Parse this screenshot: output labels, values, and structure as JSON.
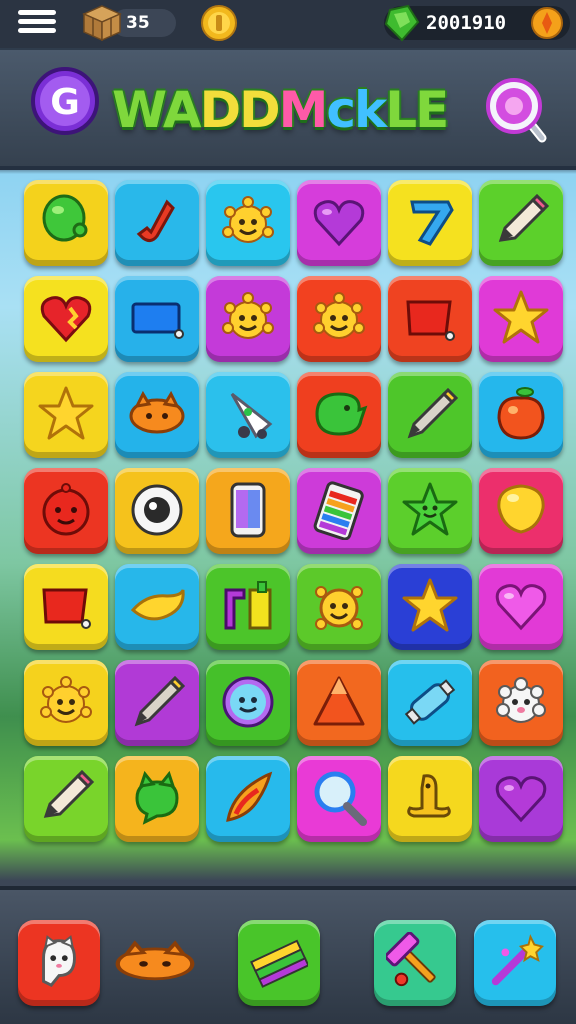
{
  "status_bar": {
    "crate_count": "35",
    "gem_balance": "2001910",
    "icons": [
      "menu-icon",
      "crate-icon",
      "coin-icon",
      "gem-icon",
      "coin-icon"
    ]
  },
  "banner": {
    "title_parts": [
      "WA",
      "DD",
      "M",
      "ck",
      "LE"
    ],
    "badge_letter": "G",
    "icons": [
      "g-badge-icon",
      "magnifier-icon"
    ]
  },
  "board": {
    "rows": 7,
    "columns": 6,
    "tiles": [
      {
        "color": "#f4d21c",
        "icon": "green-balloon-icon"
      },
      {
        "color": "#29b8ea",
        "icon": "red-hook-icon"
      },
      {
        "color": "#29c6ee",
        "icon": "sun-face-icon"
      },
      {
        "color": "#d63ddb",
        "icon": "purple-heart-icon"
      },
      {
        "color": "#f5e11f",
        "icon": "number-seven-icon"
      },
      {
        "color": "#5cd02b",
        "icon": "pencil-icon"
      },
      {
        "color": "#f5e11f",
        "icon": "broken-heart-icon"
      },
      {
        "color": "#27b1ea",
        "icon": "blue-tag-icon"
      },
      {
        "color": "#c43ad9",
        "icon": "sun-face-icon"
      },
      {
        "color": "#f24120",
        "icon": "sun-face-icon"
      },
      {
        "color": "#ef4321",
        "icon": "red-tag-icon"
      },
      {
        "color": "#e03ad7",
        "icon": "star-icon"
      },
      {
        "color": "#f5d51e",
        "icon": "star-icon"
      },
      {
        "color": "#24b3ea",
        "icon": "orange-blob-icon"
      },
      {
        "color": "#2bc0ec",
        "icon": "rocket-icon"
      },
      {
        "color": "#ef3f1f",
        "icon": "green-blob-icon"
      },
      {
        "color": "#4ec62a",
        "icon": "pen-icon"
      },
      {
        "color": "#25b7ec",
        "icon": "peach-icon"
      },
      {
        "color": "#ec3522",
        "icon": "red-face-icon"
      },
      {
        "color": "#f5c21c",
        "icon": "eyeball-icon"
      },
      {
        "color": "#f5a71c",
        "icon": "phone-icon"
      },
      {
        "color": "#cd3bd9",
        "icon": "battery-icon"
      },
      {
        "color": "#5ccf2c",
        "icon": "star-face-icon"
      },
      {
        "color": "#ec2f6c",
        "icon": "yellow-balloon-icon"
      },
      {
        "color": "#f5dc1f",
        "icon": "red-tag-icon"
      },
      {
        "color": "#27b7ea",
        "icon": "banana-icon"
      },
      {
        "color": "#4cc52a",
        "icon": "bracket-icon"
      },
      {
        "color": "#5cc92a",
        "icon": "skull-face-icon"
      },
      {
        "color": "#2a3fd6",
        "icon": "star-icon"
      },
      {
        "color": "#e23ad6",
        "icon": "pink-heart-icon"
      },
      {
        "color": "#f5d21d",
        "icon": "sun-face-icon"
      },
      {
        "color": "#b13ad6",
        "icon": "pen-icon"
      },
      {
        "color": "#45c02a",
        "icon": "smiley-ring-icon"
      },
      {
        "color": "#f2681f",
        "icon": "mountain-icon"
      },
      {
        "color": "#26bfec",
        "icon": "tube-icon"
      },
      {
        "color": "#f2621f",
        "icon": "fluffy-face-icon"
      },
      {
        "color": "#79d42b",
        "icon": "pencil-icon"
      },
      {
        "color": "#f5b41d",
        "icon": "green-cat-icon"
      },
      {
        "color": "#27baec",
        "icon": "flame-icon"
      },
      {
        "color": "#e93ad6",
        "icon": "magnifier-icon"
      },
      {
        "color": "#f5d81e",
        "icon": "octopus-icon"
      },
      {
        "color": "#a93ad8",
        "icon": "purple-heart-icon"
      }
    ]
  },
  "tray": {
    "tools": [
      {
        "color": "#ec3522",
        "icon": "ghost-face-icon"
      },
      {
        "color": "",
        "icon": "orange-blob-icon"
      },
      {
        "color": "#49c52a",
        "icon": "ruler-icon"
      },
      {
        "color": "#36c98f",
        "icon": "hammer-icon"
      },
      {
        "color": "#26bfec",
        "icon": "magic-wand-icon"
      }
    ]
  }
}
